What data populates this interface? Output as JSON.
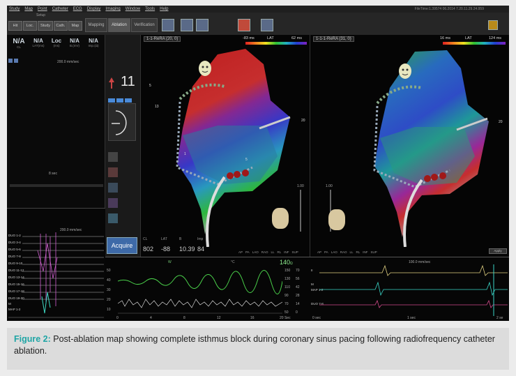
{
  "menu": [
    "Study",
    "Map",
    "Point",
    "Catheter",
    "ECG",
    "Display",
    "Imaging",
    "Window",
    "Tools",
    "Help"
  ],
  "timestamp": "FileTime:1.39574 06.2014 7.20.11.29.24.959",
  "toolbar": {
    "setup_label": "Setup",
    "buttons": [
      "Hit",
      "Loc.",
      "Study",
      "Cath.",
      "Map"
    ],
    "tabs": [
      "Mapping",
      "Ablation",
      "Verification"
    ]
  },
  "left_panel": {
    "kpis": [
      {
        "value": "N/A",
        "label": "CL"
      },
      {
        "value": "N/A",
        "label": "LAT(ms)"
      },
      {
        "value": "Loc",
        "label": "(ms)"
      },
      {
        "value": "N/A",
        "label": "B.(mV)"
      },
      {
        "value": "N/A",
        "label": "Imp.(Ω)"
      }
    ],
    "speed": "200.0 mm/sec",
    "time_label": "8 sec",
    "ecg_speed": "200.0 mm/sec",
    "ecg_leads": [
      "DUO 1-2",
      "DUO 3-4",
      "DUO 5-6",
      "DUO 7-8",
      "DUO 9-10",
      "DUO 11-12",
      "DUO 13-14",
      "DUO 15-16",
      "DUO 17-18",
      "DUO 19-20",
      "M",
      "MAP 1-2"
    ]
  },
  "tools": {
    "count": "11",
    "acquire_label": "Acquire"
  },
  "status": {
    "headers": [
      "CL",
      "LAT",
      "B",
      "Imp"
    ],
    "values": [
      "802",
      "-88",
      "10.39",
      "84"
    ]
  },
  "map_left": {
    "title": "1-1-ReRA (20, 0)",
    "lat_min": "-83 ms",
    "lat_label": "LAT",
    "lat_max": "62 ms",
    "views": [
      "AP",
      "PA",
      "LAO",
      "RAO",
      "LL",
      "RL",
      "INF",
      "SUP"
    ],
    "scale": "1.00",
    "markers": [
      "13",
      "5",
      "1",
      "5",
      "20"
    ]
  },
  "map_right": {
    "title": "1-1-1-ReRA (31, 0)",
    "lat_min": "16 ms",
    "lat_label": "LAT",
    "lat_max": "124 ms",
    "views": [
      "AP",
      "PA",
      "LAO",
      "RAO",
      "LL",
      "RL",
      "INF",
      "SUP"
    ],
    "scale": "1.00",
    "markers": [
      "20"
    ],
    "dropdown": "Apply"
  },
  "bottom_mid": {
    "left_axis": [
      "50",
      "40",
      "30",
      "20",
      "10"
    ],
    "right_axis": [
      "150",
      "130",
      "110",
      "90",
      "70",
      "50"
    ],
    "right_axis2": [
      "70",
      "56",
      "42",
      "28",
      "14",
      "0"
    ],
    "x_axis": [
      "0",
      "4",
      "8",
      "12",
      "16",
      "20 Sec"
    ],
    "label_w": "W",
    "label_c": "°C",
    "readout": "140",
    "unit": "Ω"
  },
  "bottom_right": {
    "speed": "100.0 mm/sec",
    "leads": [
      "II",
      "M",
      "MAP 1-2",
      "DUO 7-8"
    ],
    "x_axis": [
      "0 sec",
      "1 sec",
      "2 se"
    ]
  },
  "colors": {
    "accent": "#1ea5a5",
    "screen_bg": "#0b0b0b",
    "button": "#3e6aa8"
  },
  "caption": {
    "label": "Figure 2:",
    "text": " Post-ablation map showing complete isthmus block during coronary sinus pacing following radiofrequency catheter ablation."
  }
}
